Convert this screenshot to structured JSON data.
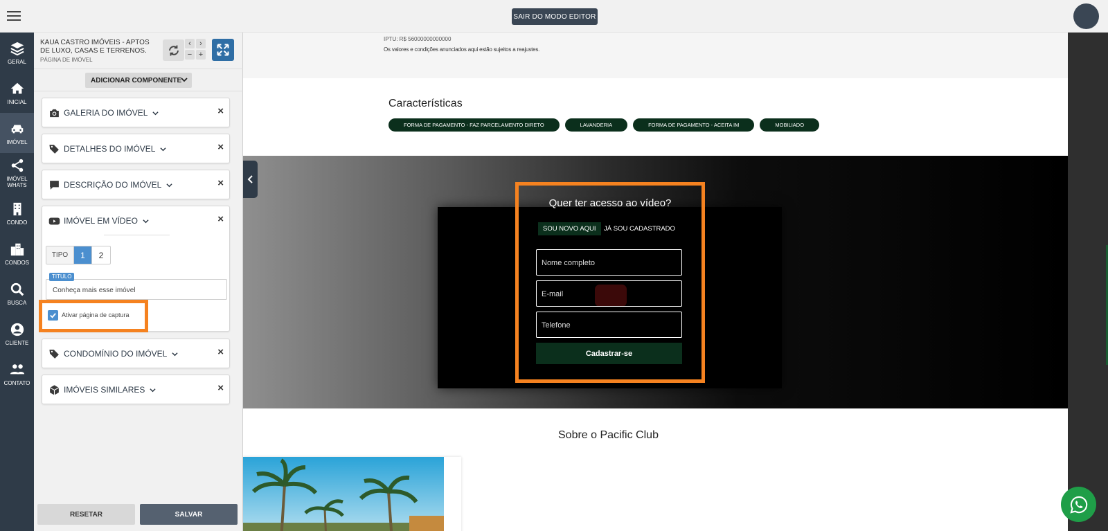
{
  "topbar": {
    "exit_editor_label": "SAIR DO MODO EDITOR"
  },
  "leftnav": {
    "items": [
      {
        "label": "GERAL",
        "icon": "layers-icon"
      },
      {
        "label": "INICIAL",
        "icon": "home-icon"
      },
      {
        "label": "IMÓVEL",
        "icon": "car-icon",
        "active": true
      },
      {
        "label": "IMÓVEL WHATS",
        "icon": "share-icon"
      },
      {
        "label": "CONDO",
        "icon": "building-icon"
      },
      {
        "label": "CONDOS",
        "icon": "buildings-icon"
      },
      {
        "label": "BUSCA",
        "icon": "search-icon"
      },
      {
        "label": "CLIENTE",
        "icon": "user-icon"
      },
      {
        "label": "CONTATO",
        "icon": "users-icon"
      }
    ]
  },
  "panel": {
    "site_name": "KAUA CASTRO IMÓVEIS - APTOS DE LUXO, CASAS E TERRENOS.",
    "page_name": "PÁGINA DE IMÓVEL",
    "add_component_label": "ADICIONAR COMPONENTE",
    "cards": [
      {
        "title": "GALERIA DO IMÓVEL",
        "icon": "camera-icon"
      },
      {
        "title": "DETALHES DO IMÓVEL",
        "icon": "tags-icon"
      },
      {
        "title": "DESCRIÇÃO DO IMÓVEL",
        "icon": "comment-icon"
      },
      {
        "title": "IMÓVEL EM VÍDEO",
        "icon": "youtube-icon"
      },
      {
        "title": "CONDOMÍNIO DO IMÓVEL",
        "icon": "tags-icon"
      },
      {
        "title": "IMÓVEIS SIMILARES",
        "icon": "box-icon"
      }
    ],
    "video_card": {
      "tipo_label": "TIPO",
      "tipo_options": [
        "1",
        "2"
      ],
      "tipo_selected": "1",
      "titulo_label": "TITULO",
      "titulo_value": "Conheça mais esse imóvel",
      "capture_label": "Ativar página de captura",
      "capture_checked": true
    },
    "reset_label": "RESETAR",
    "save_label": "SALVAR",
    "close_glyph": "×"
  },
  "preview": {
    "iptu": "IPTU: R$ 56000000000000",
    "disclaimer": "Os valores e condições anunciados aqui estão sujeitos a reajustes.",
    "features_title": "Características",
    "feature_tags": [
      "FORMA DE PAGAMENTO - FAZ PARCELAMENTO DIRETO",
      "LAVANDERIA",
      "FORMA DE PAGAMENTO - ACEITA IM",
      "MOBILIADO"
    ],
    "capture_form": {
      "title": "Quer ter acesso ao vídeo?",
      "tab_new": "SOU NOVO AQUI",
      "tab_registered": "JÁ SOU CADASTRADO",
      "name_placeholder": "Nome completo",
      "email_placeholder": "E-mail",
      "phone_placeholder": "Telefone",
      "submit_label": "Cadastrar-se"
    },
    "about_title": "Sobre o Pacific Club"
  },
  "colors": {
    "nav_bg": "#2f3b48",
    "accent_blue": "#4b8fcf",
    "highlight_orange": "#f58220",
    "brand_green": "#0b2f1c",
    "whatsapp_green": "#1f9e48"
  }
}
